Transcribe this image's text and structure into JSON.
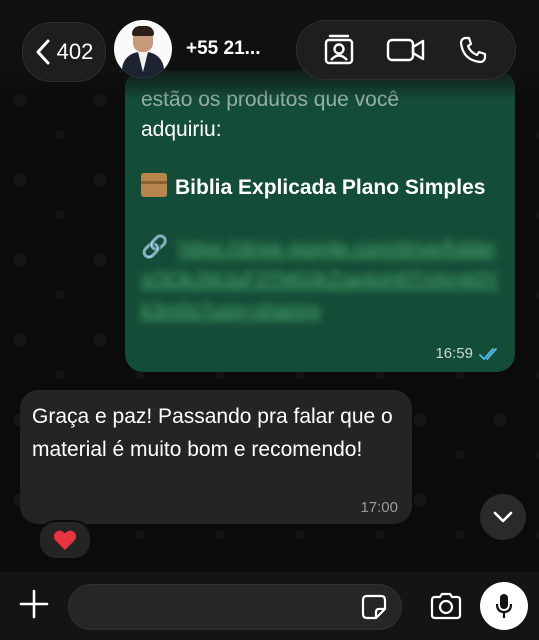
{
  "header": {
    "back_count": "402",
    "contact_name": "+55 21...",
    "icons": {
      "back": "chevron-left-icon",
      "contact_card": "contact-card-icon",
      "video": "video-camera-icon",
      "phone": "phone-icon"
    }
  },
  "messages": [
    {
      "direction": "outgoing",
      "partial_text": "estão os produtos que você",
      "line": "adquiriu:",
      "product_icon": "package-emoji",
      "product_title": "Biblia Explicada Plano Simples",
      "link_icon": "link-emoji",
      "link_text": "https://drive.google.com/drive/folders/3OkJWJuF3TMG9rZoe4oH0Tmlvyk0Yk3m0s?usp=sharing",
      "time": "16:59",
      "status": "read"
    },
    {
      "direction": "incoming",
      "text": "Graça e paz! Passando pra falar que o material é muito bom e recomendo!",
      "time": "17:00",
      "reaction": "heart"
    }
  ],
  "composer": {
    "placeholder": "",
    "icons": [
      "plus-icon",
      "sticker-icon",
      "camera-icon",
      "microphone-icon"
    ]
  },
  "colors": {
    "outgoing_bubble": "#144d37",
    "incoming_bubble": "#242424",
    "read_ticks": "#53bdeb",
    "background": "#0b0b0b"
  }
}
